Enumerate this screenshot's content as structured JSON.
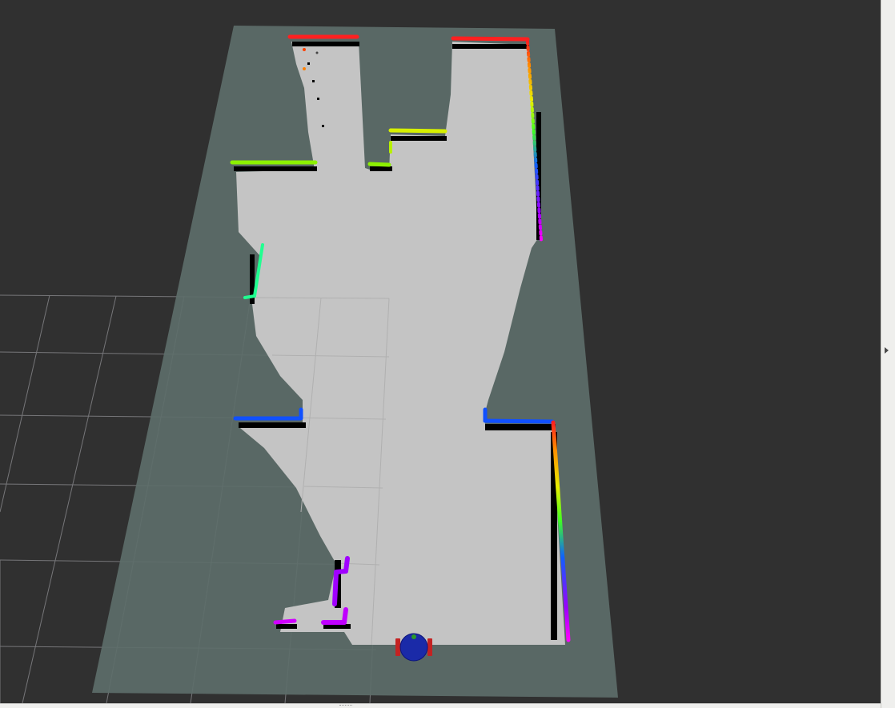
{
  "app": {
    "view": "3D render view",
    "colors": {
      "background": "#303030",
      "grid_line": "#a0a0a4",
      "map_unknown": "#5f6f6c",
      "map_free": "#c4c4c4",
      "map_occupied": "#000000",
      "robot_body": "#1a2aa8",
      "robot_wheel": "#c42222",
      "side_panel": "#efefed"
    },
    "scan_color_gradient": [
      "#ff1a1a",
      "#ff7a00",
      "#e6ff00",
      "#7cff00",
      "#1cff9a",
      "#1050ff",
      "#a000ff",
      "#ff00ff"
    ],
    "side_panel": {
      "collapsed": true,
      "toggle_icon": "triangle-right-icon"
    }
  }
}
